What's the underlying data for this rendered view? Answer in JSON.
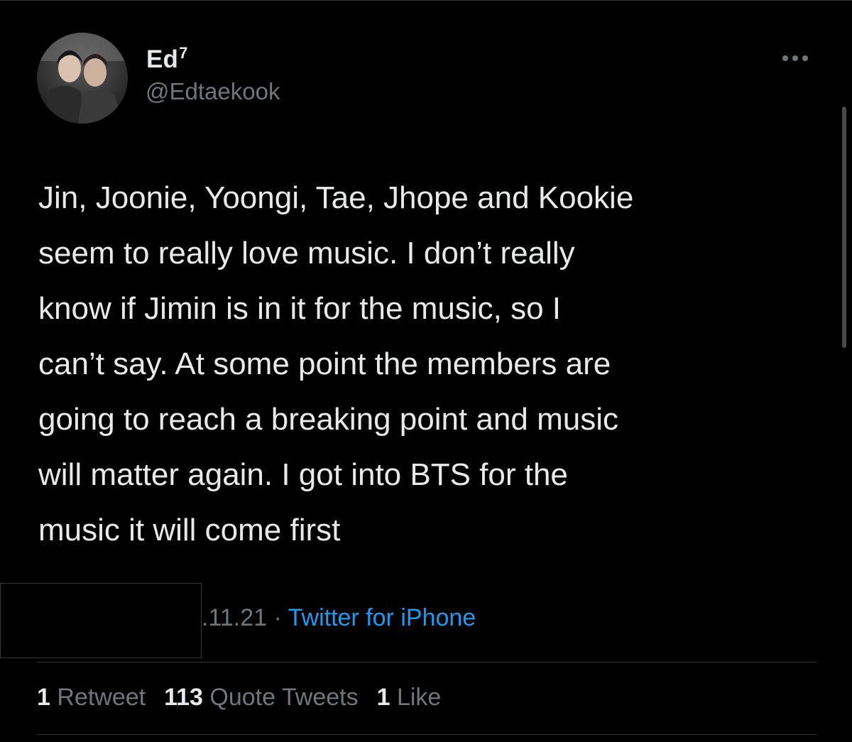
{
  "tweet": {
    "author": {
      "display_name": "Ed",
      "display_name_suffix": "7",
      "handle": "@Edtaekook"
    },
    "text_lines": [
      "Jin, Joonie, Yoongi, Tae, Jhope and Kookie",
      "seem to really love music. I don’t really",
      "know if Jimin is in it for the music, so I",
      "can’t say. At some point the members are",
      "going to reach a breaking point and music",
      "will matter again. I got into BTS for the",
      "music it will come first"
    ],
    "date_fragment": ".11.21",
    "separator": " · ",
    "source": "Twitter for iPhone",
    "stats": {
      "retweets_count": "1",
      "retweets_label": "Retweet",
      "quotes_count": "113",
      "quotes_label": "Quote Tweets",
      "likes_count": "1",
      "likes_label": "Like"
    }
  },
  "icons": {
    "more": "more-horizontal-icon",
    "avatar": "profile-avatar"
  },
  "colors": {
    "background": "#000000",
    "text": "#e7e9ea",
    "secondary_text": "#71767b",
    "link": "#1d9bf0",
    "divider": "#2f3336"
  }
}
